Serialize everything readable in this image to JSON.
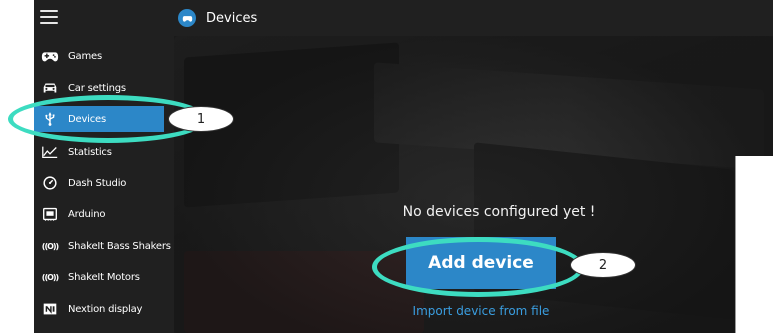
{
  "app": {
    "header_title": "Devices"
  },
  "sidebar": {
    "items": [
      {
        "label": "Games",
        "icon": "gamepad-icon"
      },
      {
        "label": "Car settings",
        "icon": "car-icon"
      },
      {
        "label": "Devices",
        "icon": "usb-icon",
        "active": true
      },
      {
        "label": "Statistics",
        "icon": "chart-line-icon"
      },
      {
        "label": "Dash Studio",
        "icon": "gauge-icon"
      },
      {
        "label": "Arduino",
        "icon": "arduino-board-icon"
      },
      {
        "label": "ShakeIt Bass Shakers",
        "icon": "vibration-icon"
      },
      {
        "label": "ShakeIt Motors",
        "icon": "vibration-icon"
      },
      {
        "label": "Nextion display",
        "icon": "nextion-icon"
      }
    ]
  },
  "main": {
    "empty_message": "No devices configured yet !",
    "add_button_label": "Add device",
    "import_link": "Import device from file"
  },
  "annotations": {
    "callout_1": "1",
    "callout_2": "2"
  },
  "colors": {
    "accent": "#2c87c8",
    "annotation_ring": "#3ddcc1",
    "background": "#202020",
    "link": "#3a9ee0"
  }
}
